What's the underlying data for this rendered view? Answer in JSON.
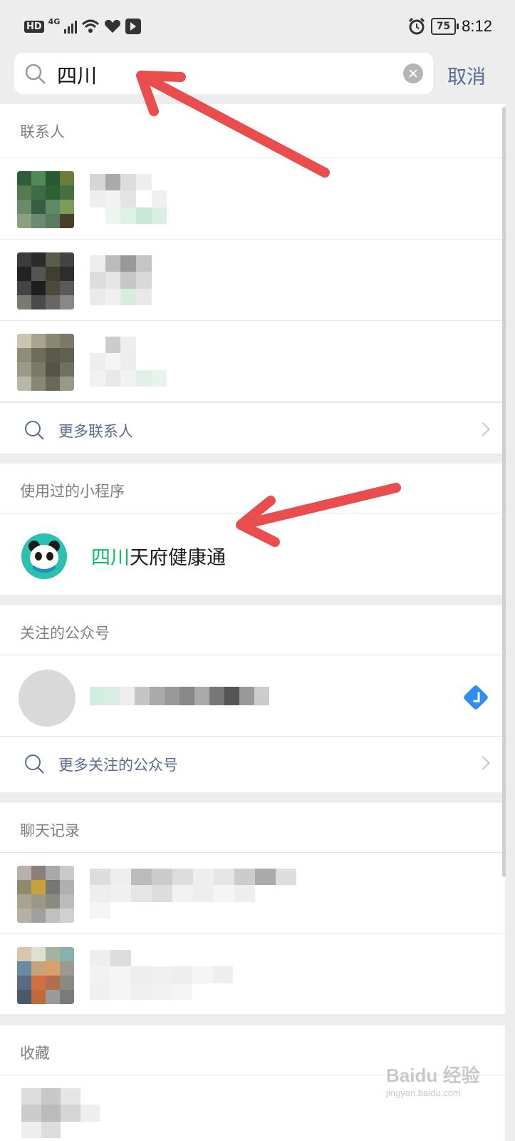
{
  "status_bar": {
    "hd_label": "HD",
    "network": "4G",
    "battery": "75",
    "time": "8:12"
  },
  "search": {
    "query": "四川",
    "cancel_label": "取消"
  },
  "contacts": {
    "title": "联系人",
    "more_label": "更多联系人"
  },
  "mini_programs": {
    "title": "使用过的小程序",
    "items": [
      {
        "highlight": "四川",
        "rest": "天府健康通"
      }
    ]
  },
  "official_accounts": {
    "title": "关注的公众号",
    "more_label": "更多关注的公众号"
  },
  "chat_history": {
    "title": "聊天记录"
  },
  "favorites": {
    "title": "收藏"
  },
  "colors": {
    "accent": "#576b95",
    "highlight": "#07c160",
    "annotation_arrow": "#ea4d4d"
  },
  "watermark": {
    "brand": "Baidu 经验",
    "url": "jingyan.baidu.com"
  }
}
